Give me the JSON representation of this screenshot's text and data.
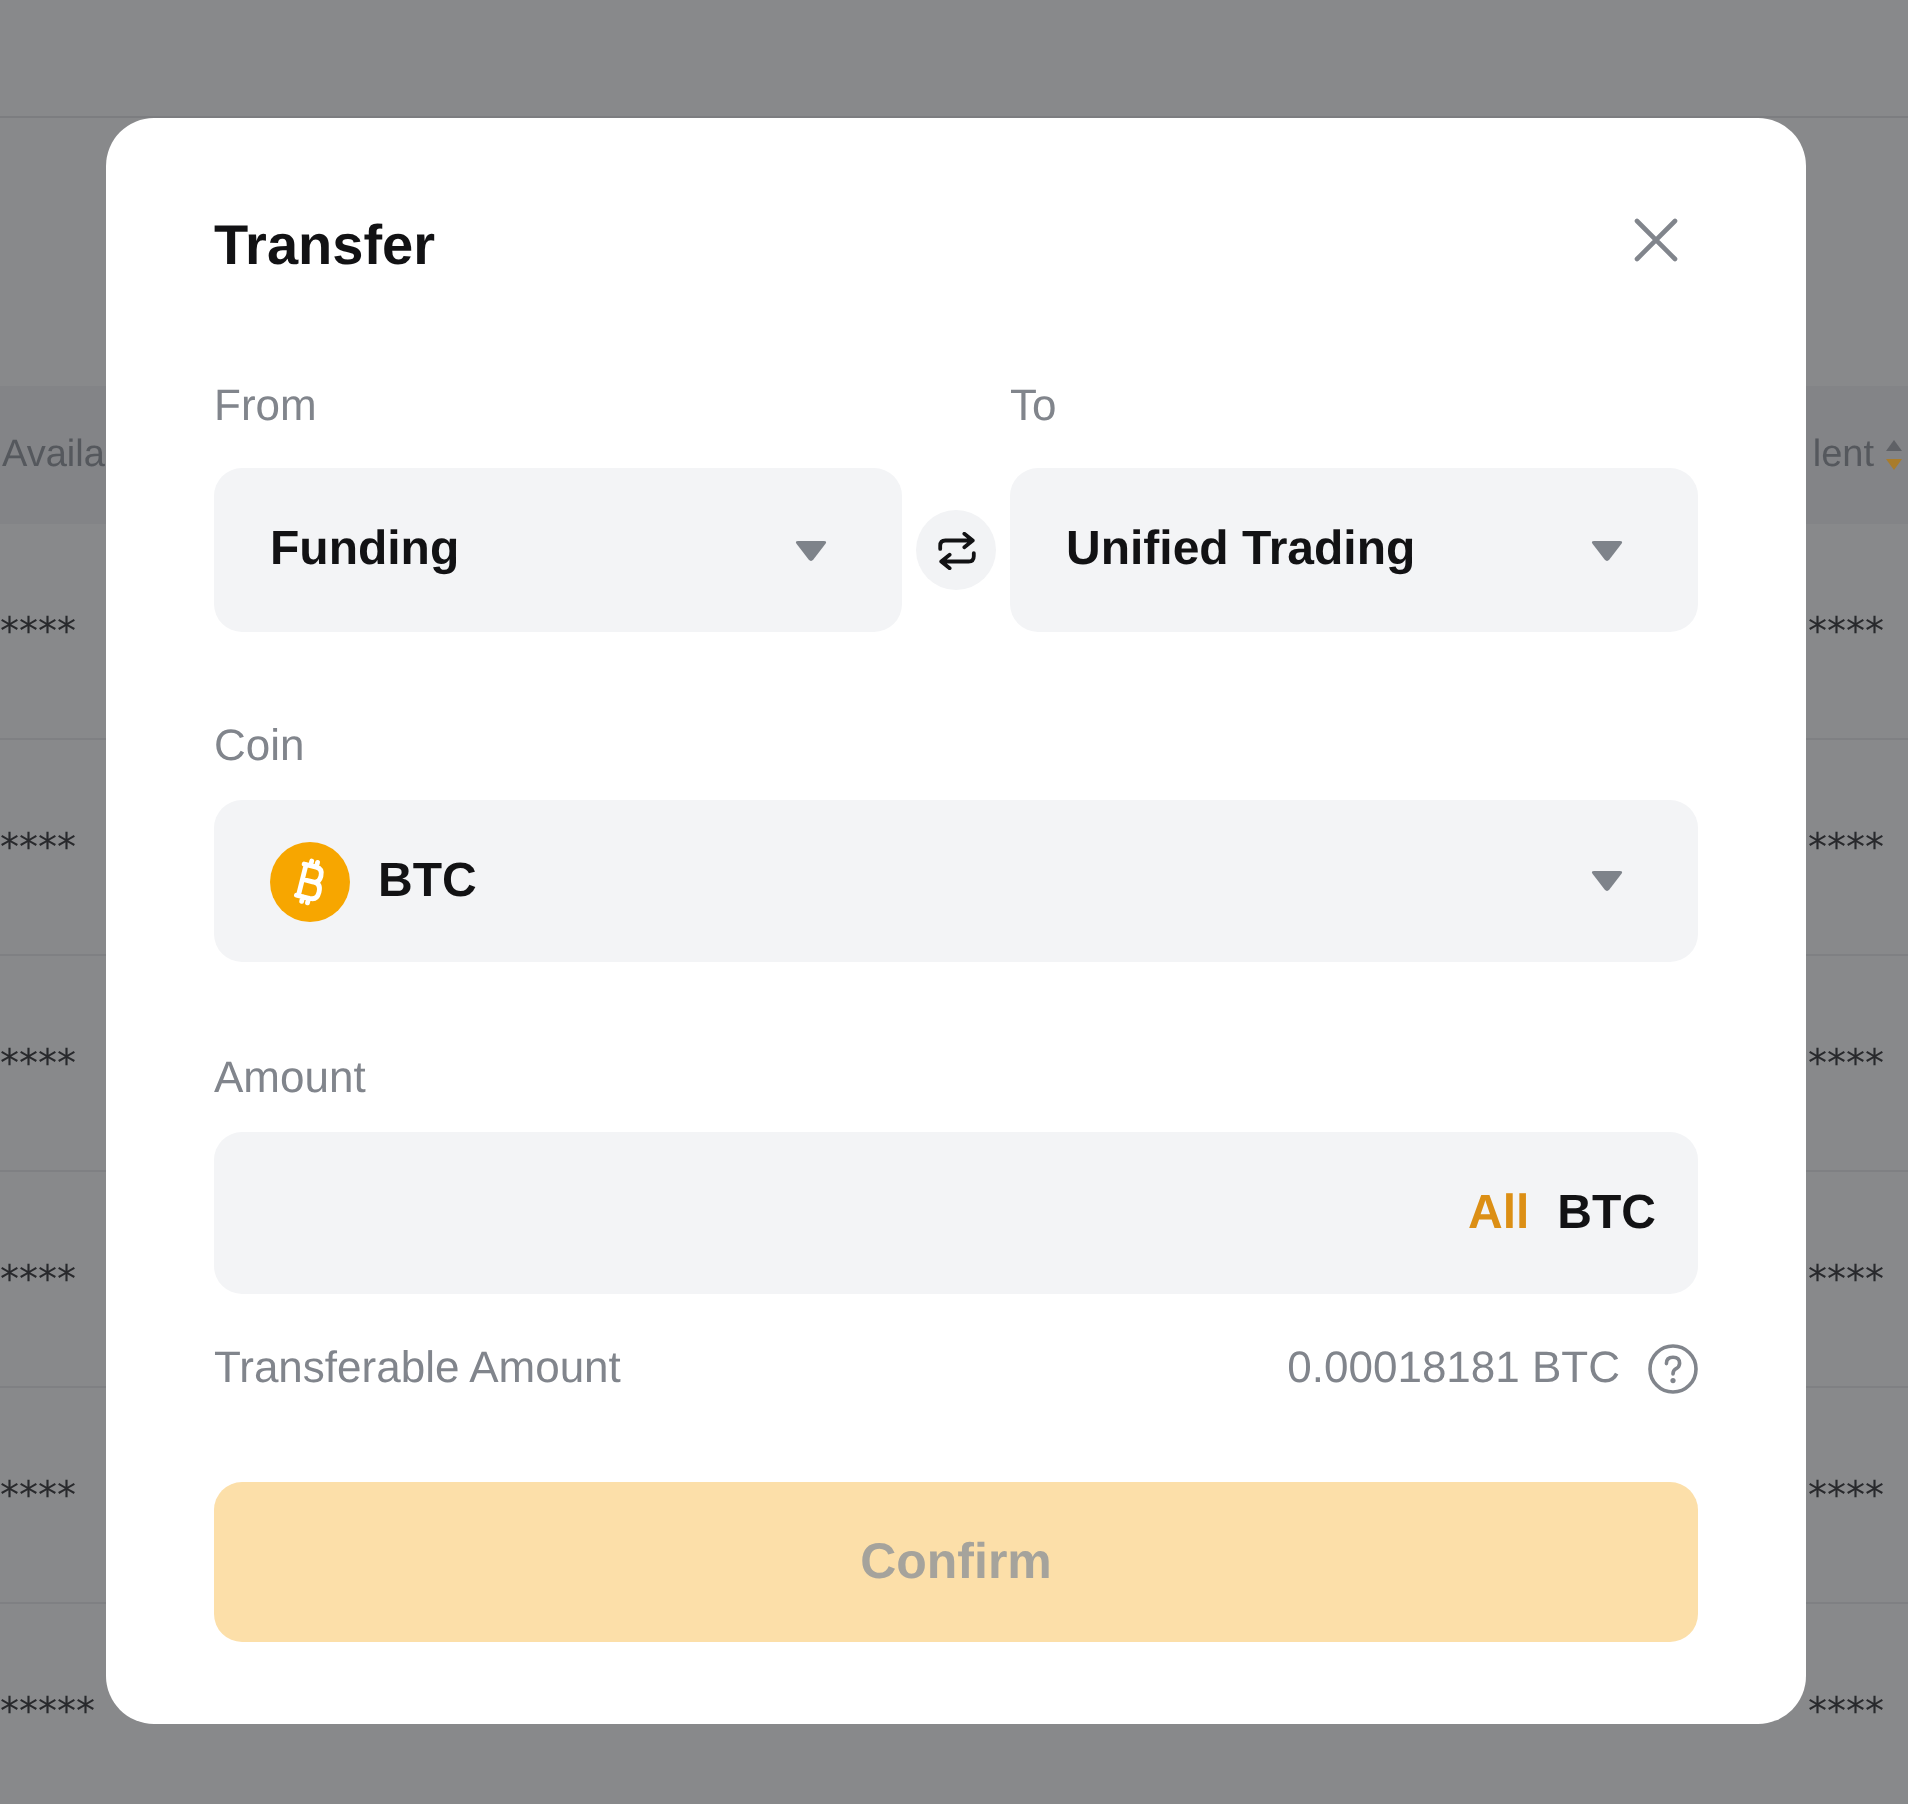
{
  "background": {
    "table": {
      "columns": [
        {
          "label": "Availa"
        },
        {
          "label": "lent",
          "sort_descending": true
        }
      ],
      "rows": [
        {
          "cells": [
            "****",
            "****"
          ]
        },
        {
          "cells": [
            "****",
            "****"
          ]
        },
        {
          "cells": [
            "****",
            "****"
          ]
        },
        {
          "cells": [
            "****",
            "****"
          ]
        },
        {
          "cells": [
            "****",
            "****"
          ]
        },
        {
          "cells": [
            "*****",
            "****"
          ]
        }
      ]
    }
  },
  "dialog": {
    "title": "Transfer",
    "from": {
      "label": "From",
      "value": "Funding"
    },
    "to": {
      "label": "To",
      "value": "Unified Trading"
    },
    "coin": {
      "label": "Coin",
      "value": "BTC"
    },
    "amount": {
      "label": "Amount",
      "all": "All",
      "unit": "BTC"
    },
    "transferable": {
      "label": "Transferable Amount",
      "value": "0.00018181 BTC"
    },
    "confirm": {
      "label": "Confirm",
      "disabled": true
    }
  }
}
